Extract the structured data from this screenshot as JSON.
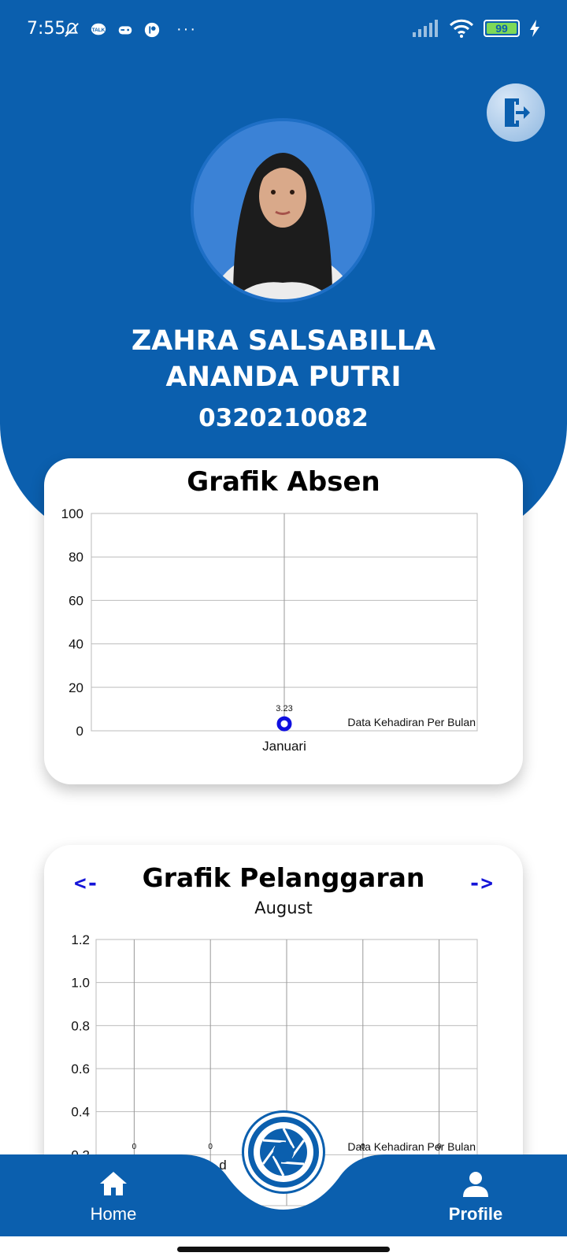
{
  "status_bar": {
    "time": "7:55",
    "battery": "99",
    "left_icons": [
      "mute-icon",
      "talk-icon",
      "game-icon",
      "app-icon"
    ],
    "more": "···"
  },
  "profile": {
    "name_line1": "ZAHRA SALSABILLA",
    "name_line2": "ANANDA PUTRI",
    "nis": "0320210082"
  },
  "colors": {
    "primary": "#0b5fae",
    "accent": "#1414d8"
  },
  "attendance_card": {
    "title": "Grafik Absen"
  },
  "violation_card": {
    "title": "Grafik Pelanggaran",
    "prev_label": "<-",
    "next_label": "->",
    "month": "August"
  },
  "chart_data": [
    {
      "type": "scatter",
      "title": "Grafik Absen",
      "categories": [
        "Januari"
      ],
      "series": [
        {
          "name": "Data Kehadiran Per Bulan",
          "values": [
            3.23
          ]
        }
      ],
      "data_labels": [
        "3.23"
      ],
      "ylim": [
        0,
        100
      ],
      "yticks": [
        "0",
        "20",
        "40",
        "60",
        "80",
        "100"
      ],
      "legend": "bottom-right",
      "legend_label": "Data Kehadiran Per Bulan",
      "grid": true
    },
    {
      "type": "bar",
      "title": "Grafik Pelanggaran",
      "subtitle": "August",
      "categories": [
        "",
        "",
        "",
        "",
        ""
      ],
      "series": [
        {
          "name": "Data Kehadiran Per Bulan",
          "values": [
            0,
            0,
            0,
            0,
            0
          ]
        }
      ],
      "data_labels": [
        "0",
        "0",
        "0",
        "0",
        "0"
      ],
      "ylim": [
        0,
        1.2
      ],
      "yticks": [
        "0.2",
        "0.4",
        "0.6",
        "0.8",
        "1.0",
        "1.2"
      ],
      "visible_xtick": "d",
      "legend": "bottom-right",
      "legend_label": "Data Kehadiran Per Bulan",
      "grid": true
    }
  ],
  "bottom_nav": {
    "home_label": "Home",
    "profile_label": "Profile"
  }
}
